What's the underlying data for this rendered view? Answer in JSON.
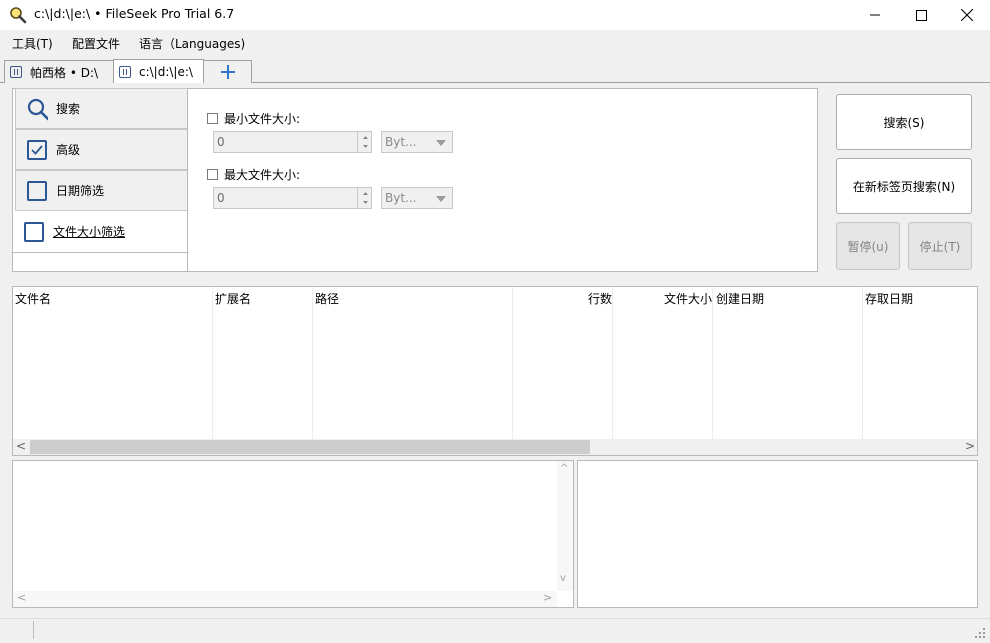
{
  "window": {
    "title": "c:\\|d:\\|e:\\ • FileSeek Pro Trial 6.7"
  },
  "menu": {
    "items": [
      "工具(T)",
      "配置文件",
      "语言（Languages)"
    ]
  },
  "tabs": [
    {
      "label": "帕西格 • D:\\"
    },
    {
      "label": "c:\\|d:\\|e:\\"
    }
  ],
  "nav": {
    "items": [
      {
        "label": "搜索",
        "icon": "search-icon"
      },
      {
        "label": "高级",
        "icon": "checkbox-checked-icon"
      },
      {
        "label": "日期筛选",
        "icon": "checkbox-icon"
      },
      {
        "label": "文件大小筛选",
        "icon": "checkbox-icon"
      }
    ]
  },
  "filters": {
    "min_label": "最小文件大小:",
    "min_value": "0",
    "min_unit": "Byt...",
    "max_label": "最大文件大小:",
    "max_value": "0",
    "max_unit": "Byt..."
  },
  "buttons": {
    "search": "搜索(S)",
    "search_new_tab": "在新标签页搜索(N)",
    "pause": "暂停(u)",
    "stop": "停止(T)"
  },
  "results": {
    "columns": [
      "文件名",
      "扩展名",
      "路径",
      "行数",
      "文件大小",
      "创建日期",
      "存取日期"
    ],
    "scroll_left": "<",
    "scroll_right": ">"
  },
  "preview": {
    "scroll_up": "^",
    "scroll_down": "v",
    "scroll_left": "<",
    "scroll_right": ">"
  },
  "colors": {
    "accent": "#2b5797",
    "tab_plus": "#1b6ac9",
    "disabled_bg": "#e5e5e5"
  }
}
